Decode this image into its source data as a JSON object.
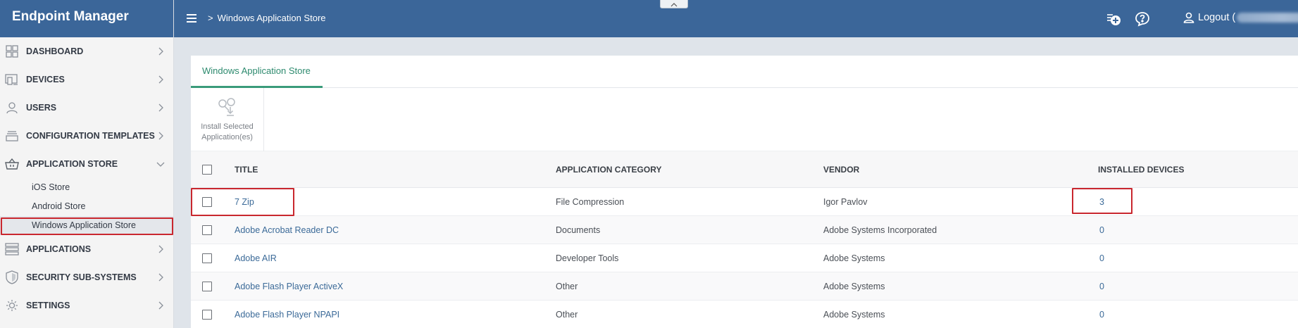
{
  "app": {
    "title": "Endpoint Manager"
  },
  "sidebar": {
    "items": [
      {
        "label": "DASHBOARD",
        "icon": "grid-icon",
        "expanded": false
      },
      {
        "label": "DEVICES",
        "icon": "devices-icon",
        "expanded": false
      },
      {
        "label": "USERS",
        "icon": "user-icon",
        "expanded": false
      },
      {
        "label": "CONFIGURATION TEMPLATES",
        "icon": "layers-icon",
        "expanded": false
      },
      {
        "label": "APPLICATION STORE",
        "icon": "basket-icon",
        "expanded": true
      },
      {
        "label": "APPLICATIONS",
        "icon": "applications-icon",
        "expanded": false
      },
      {
        "label": "SECURITY SUB-SYSTEMS",
        "icon": "shield-icon",
        "expanded": false
      },
      {
        "label": "SETTINGS",
        "icon": "gear-icon",
        "expanded": false
      }
    ],
    "sub_items": [
      {
        "label": "iOS Store"
      },
      {
        "label": "Android Store"
      },
      {
        "label": "Windows Application Store",
        "active": true
      }
    ]
  },
  "header": {
    "breadcrumb_sep": ">",
    "breadcrumb": "Windows Application Store",
    "logout_label": "Logout ("
  },
  "main": {
    "tab_label": "Windows Application Store",
    "toolbar": {
      "install_label_1": "Install Selected",
      "install_label_2": "Application(es)"
    },
    "table": {
      "columns": [
        "TITLE",
        "APPLICATION CATEGORY",
        "VENDOR",
        "INSTALLED DEVICES"
      ],
      "rows": [
        {
          "title": "7 Zip",
          "category": "File Compression",
          "vendor": "Igor Pavlov",
          "installed": "3"
        },
        {
          "title": "Adobe Acrobat Reader DC",
          "category": "Documents",
          "vendor": "Adobe Systems Incorporated",
          "installed": "0"
        },
        {
          "title": "Adobe AIR",
          "category": "Developer Tools",
          "vendor": "Adobe Systems",
          "installed": "0"
        },
        {
          "title": "Adobe Flash Player ActiveX",
          "category": "Other",
          "vendor": "Adobe Systems",
          "installed": "0"
        },
        {
          "title": "Adobe Flash Player NPAPI",
          "category": "Other",
          "vendor": "Adobe Systems",
          "installed": "0"
        }
      ]
    }
  },
  "colors": {
    "header_bg": "#3b6699",
    "highlight_box": "#c9272e",
    "tab_accent": "#3a9b7a",
    "link": "#3b6a98"
  }
}
